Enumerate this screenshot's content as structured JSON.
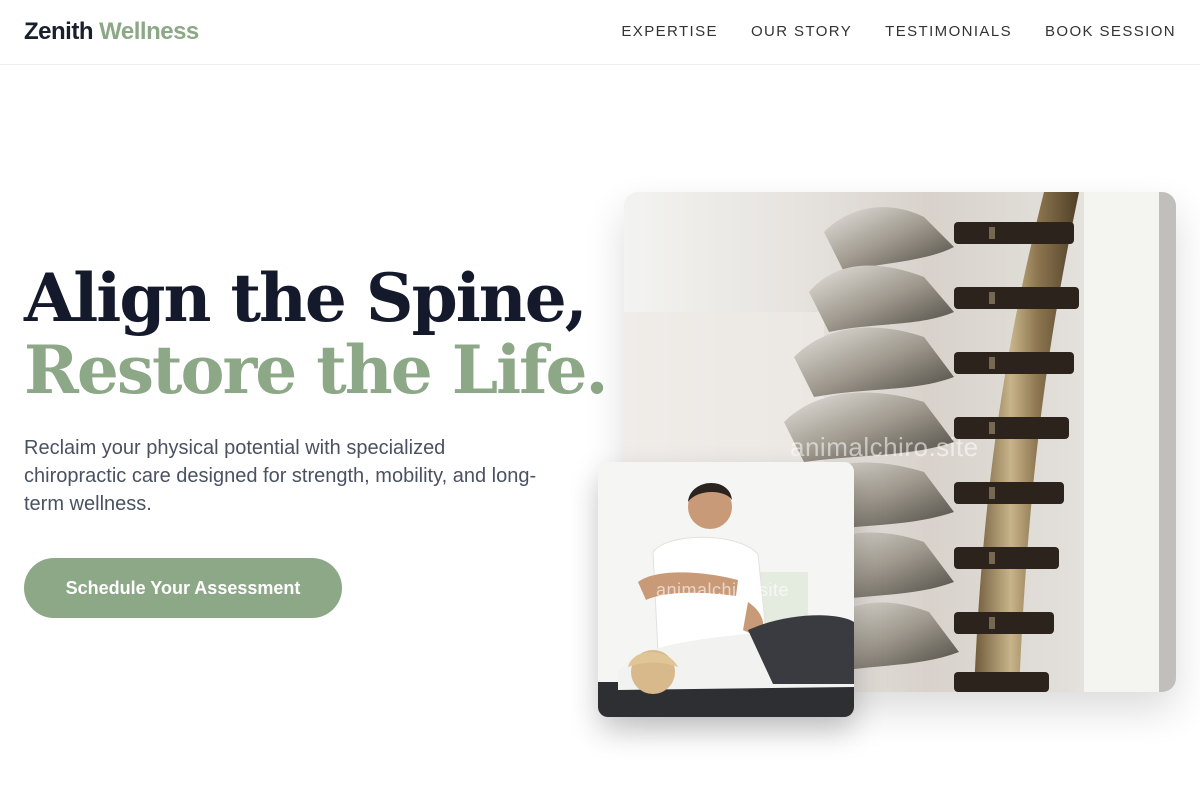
{
  "brand": {
    "name_part1": "Zenith",
    "name_part2": "Wellness"
  },
  "nav": {
    "links": [
      {
        "label": "EXPERTISE"
      },
      {
        "label": "OUR STORY"
      },
      {
        "label": "TESTIMONIALS"
      },
      {
        "label": "BOOK SESSION"
      }
    ]
  },
  "hero": {
    "headline_line1": "Align the Spine,",
    "headline_line2": "Restore the Life.",
    "subtext": "Reclaim your physical potential with specialized chiropractic care designed for strength, mobility, and long-term wellness.",
    "cta_label": "Schedule Your Assessment"
  },
  "images": {
    "main": {
      "alt": "Spine model photo",
      "watermark": "animalchiro.site"
    },
    "secondary": {
      "alt": "Chiropractor adjusting a patient",
      "watermark": "animalchiro.site"
    }
  },
  "colors": {
    "accent": "#8ca887",
    "heading": "#141a2c",
    "body_text": "#4a5160"
  }
}
